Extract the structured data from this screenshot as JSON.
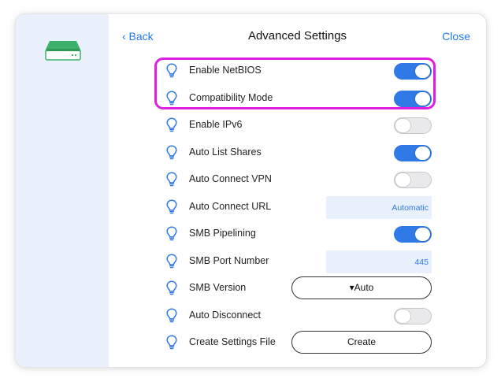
{
  "header": {
    "back_label": "‹ Back",
    "title": "Advanced Settings",
    "close_label": "Close"
  },
  "colors": {
    "accent": "#2f7ae6",
    "highlight": "#e01ee0",
    "sidebar_bg": "#eaf1fc",
    "drive_green": "#3db06a"
  },
  "sidebar": {
    "icon": "network-drive-icon"
  },
  "settings": [
    {
      "label": "Enable NetBIOS",
      "type": "toggle",
      "on": true
    },
    {
      "label": "Compatibility Mode",
      "type": "toggle",
      "on": true
    },
    {
      "label": "Enable IPv6",
      "type": "toggle",
      "on": false
    },
    {
      "label": "Auto List Shares",
      "type": "toggle",
      "on": true
    },
    {
      "label": "Auto Connect VPN",
      "type": "toggle",
      "on": false
    },
    {
      "label": "Auto Connect URL",
      "type": "field",
      "value": "Automatic"
    },
    {
      "label": "SMB Pipelining",
      "type": "toggle",
      "on": true
    },
    {
      "label": "SMB Port Number",
      "type": "field",
      "value": "445"
    },
    {
      "label": "SMB Version",
      "type": "select",
      "value": "▾Auto"
    },
    {
      "label": "Auto Disconnect",
      "type": "toggle",
      "on": false
    },
    {
      "label": "Create Settings File",
      "type": "button",
      "value": "Create"
    }
  ]
}
